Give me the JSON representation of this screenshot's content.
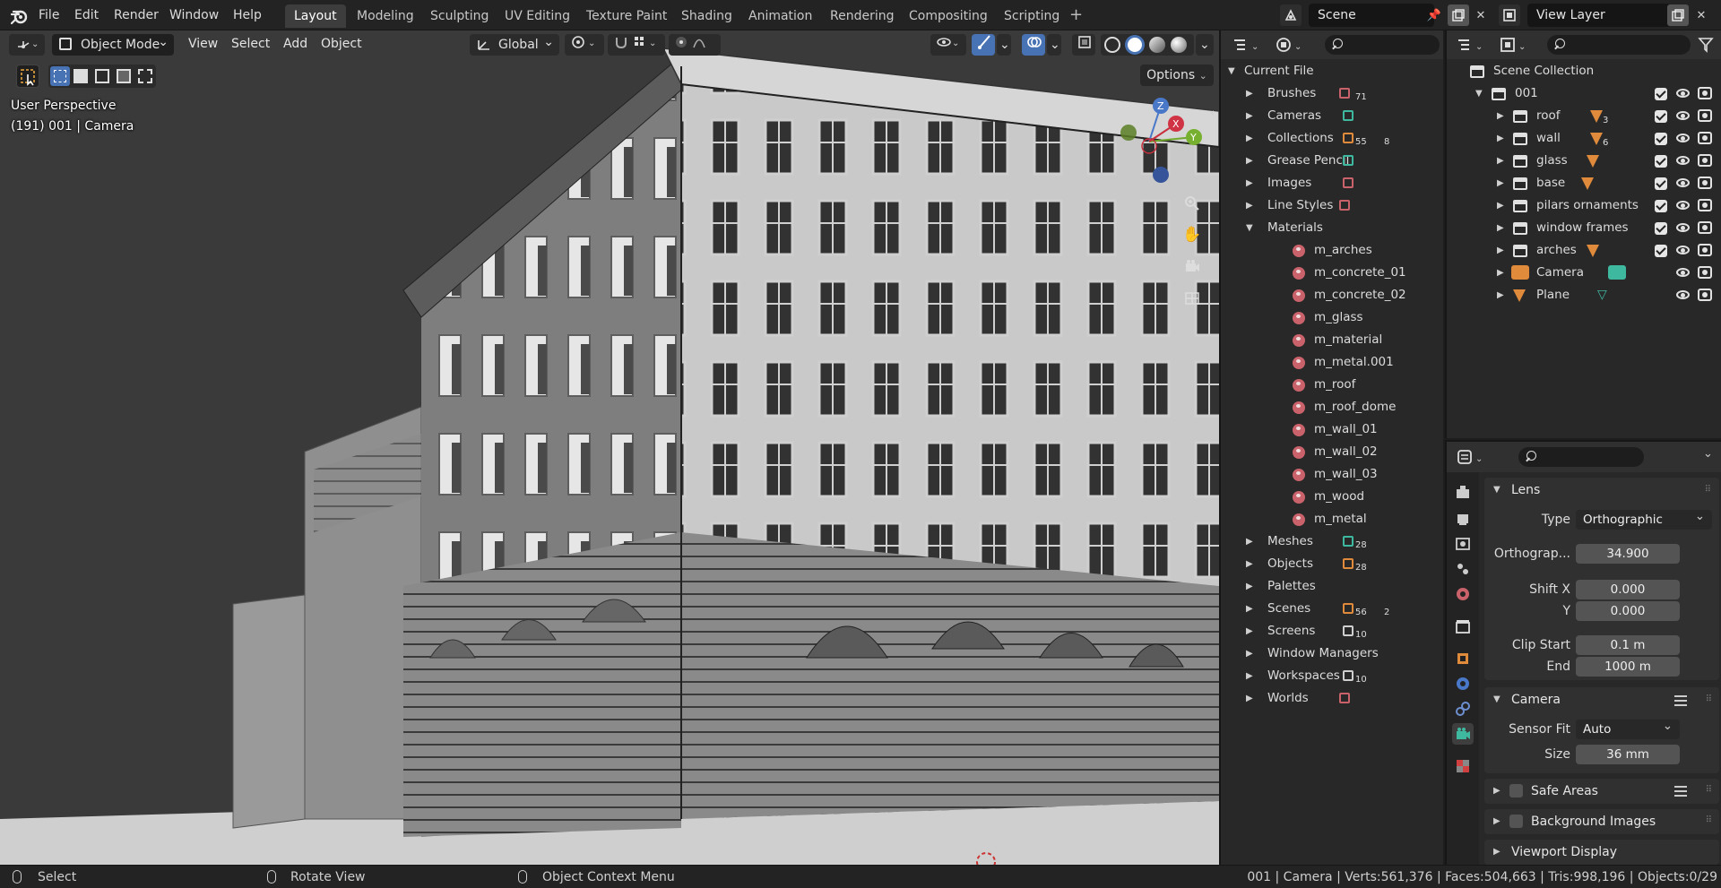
{
  "topbar": {
    "menus": [
      "File",
      "Edit",
      "Render",
      "Window",
      "Help"
    ],
    "workspaces": [
      "Layout",
      "Modeling",
      "Sculpting",
      "UV Editing",
      "Texture Paint",
      "Shading",
      "Animation",
      "Rendering",
      "Compositing",
      "Scripting"
    ],
    "active_workspace": "Layout",
    "add_workspace": "+",
    "scene_name": "Scene",
    "view_layer_name": "View Layer"
  },
  "viewport": {
    "mode": "Object Mode",
    "menus": [
      "View",
      "Select",
      "Add",
      "Object"
    ],
    "orientation": "Global",
    "options_label": "Options",
    "perspective_label": "User Perspective",
    "object_info": "(191) 001 | Camera",
    "gizmo": {
      "x": "X",
      "y": "Y",
      "z": "Z"
    }
  },
  "blend_file": {
    "root": "Current File",
    "items": [
      {
        "label": "Brushes",
        "count": "71",
        "expanded": false
      },
      {
        "label": "Cameras",
        "count": "",
        "expanded": false
      },
      {
        "label": "Collections",
        "count": "55",
        "count2": "8",
        "expanded": false
      },
      {
        "label": "Grease Pencil",
        "count": "",
        "expanded": false
      },
      {
        "label": "Images",
        "count": "",
        "expanded": false
      },
      {
        "label": "Line Styles",
        "count": "",
        "expanded": false
      },
      {
        "label": "Materials",
        "count": "",
        "expanded": true
      }
    ],
    "materials": [
      "m_arches",
      "m_concrete_01",
      "m_concrete_02",
      "m_glass",
      "m_material",
      "m_metal.001",
      "m_roof",
      "m_roof_dome",
      "m_wall_01",
      "m_wall_02",
      "m_wall_03",
      "m_wood",
      "m_metal"
    ],
    "items_after": [
      {
        "label": "Meshes",
        "count": "28"
      },
      {
        "label": "Objects",
        "count": "28"
      },
      {
        "label": "Palettes",
        "count": ""
      },
      {
        "label": "Scenes",
        "count": "56",
        "count2": "2"
      },
      {
        "label": "Screens",
        "count": "10"
      },
      {
        "label": "Window Managers",
        "count": ""
      },
      {
        "label": "Workspaces",
        "count": "10"
      },
      {
        "label": "Worlds",
        "count": ""
      }
    ]
  },
  "outliner": {
    "root": "Scene Collection",
    "collection": "001",
    "children": [
      {
        "label": "roof",
        "count": "3",
        "type": "collection"
      },
      {
        "label": "wall",
        "count": "6",
        "type": "collection"
      },
      {
        "label": "glass",
        "count": "",
        "type": "collection"
      },
      {
        "label": "base",
        "count": "",
        "type": "collection"
      },
      {
        "label": "pilars ornaments",
        "count": "",
        "type": "collection"
      },
      {
        "label": "window frames",
        "count": "",
        "type": "collection"
      },
      {
        "label": "arches",
        "count": "",
        "type": "collection"
      },
      {
        "label": "Camera",
        "count": "",
        "type": "camera"
      },
      {
        "label": "Plane",
        "count": "",
        "type": "mesh"
      }
    ]
  },
  "properties": {
    "lens_title": "Lens",
    "type_label": "Type",
    "type_value": "Orthographic",
    "ortho_label": "Orthograp...",
    "ortho_value": "34.900",
    "shift_x_label": "Shift X",
    "shift_x_value": "0.000",
    "shift_y_label": "Y",
    "shift_y_value": "0.000",
    "clip_start_label": "Clip Start",
    "clip_start_value": "0.1 m",
    "clip_end_label": "End",
    "clip_end_value": "1000 m",
    "camera_title": "Camera",
    "sensor_fit_label": "Sensor Fit",
    "sensor_fit_value": "Auto",
    "size_label": "Size",
    "size_value": "36 mm",
    "safe_areas_title": "Safe Areas",
    "background_images_title": "Background Images",
    "viewport_display_title": "Viewport Display"
  },
  "statusbar": {
    "select": "Select",
    "rotate": "Rotate View",
    "context_menu": "Object Context Menu",
    "stats": "001 | Camera | Verts:561,376 | Faces:504,663 | Tris:998,196 | Objects:0/29"
  },
  "colors": {
    "accent": "#4772b3",
    "orange": "#e08a3c",
    "material": "#c9626a",
    "teal": "#3fb8a0"
  }
}
